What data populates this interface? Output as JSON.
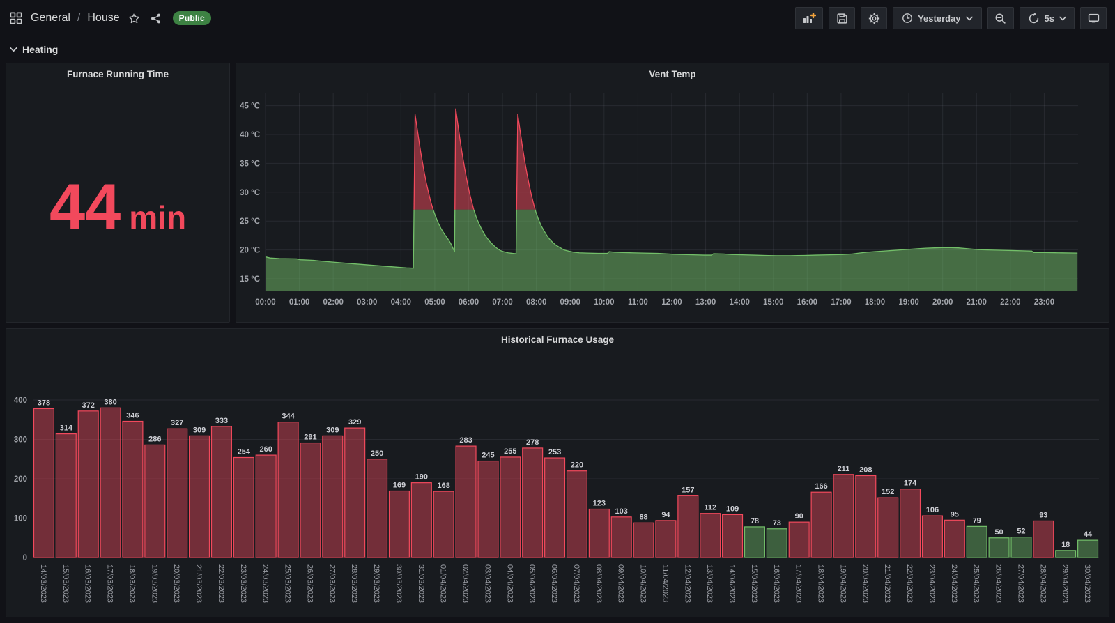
{
  "header": {
    "breadcrumb": {
      "section": "General",
      "separator": "/",
      "page": "House"
    },
    "badge": "Public",
    "time_range": "Yesterday",
    "refresh": "5s"
  },
  "row": {
    "title": "Heating"
  },
  "stat_panel": {
    "title": "Furnace Running Time",
    "value": "44",
    "unit": "min",
    "color": "#F2495C"
  },
  "icons": {
    "dashboards-icon": "four-squares-grid",
    "star-icon": "star-outline",
    "share-icon": "share-nodes",
    "add-panel-icon": "bar-chart-plus",
    "save-icon": "floppy-disk",
    "settings-icon": "gear",
    "clock-icon": "clock",
    "chevron-down-icon": "chevron-down",
    "zoom-out-icon": "magnifier-minus",
    "refresh-icon": "circular-arrows",
    "tv-icon": "monitor",
    "accent_orange": "#F2A33C",
    "icon_color": "#c7c9cc"
  },
  "chart_data": [
    {
      "type": "area",
      "title": "Vent Temp",
      "ylim": [
        12.9,
        47.3
      ],
      "yticks": [
        15,
        20,
        25,
        30,
        35,
        40,
        45
      ],
      "ytick_suffix": " °C",
      "xticks": [
        "00:00",
        "01:00",
        "02:00",
        "03:00",
        "04:00",
        "05:00",
        "06:00",
        "07:00",
        "08:00",
        "09:00",
        "10:00",
        "11:00",
        "12:00",
        "13:00",
        "14:00",
        "15:00",
        "16:00",
        "17:00",
        "18:00",
        "19:00",
        "20:00",
        "21:00",
        "22:00",
        "23:00"
      ],
      "x_total_minutes": 1440,
      "threshold": 27,
      "color_below": "#73BF69",
      "color_above": "#F2495C",
      "fill_opacity": 0.5,
      "grid": true,
      "points": [
        [
          0,
          18.8
        ],
        [
          8,
          18.6
        ],
        [
          25,
          18.5
        ],
        [
          55,
          18.45
        ],
        [
          62,
          18.3
        ],
        [
          85,
          18.2
        ],
        [
          100,
          18.05
        ],
        [
          118,
          17.9
        ],
        [
          137,
          17.75
        ],
        [
          155,
          17.6
        ],
        [
          175,
          17.45
        ],
        [
          195,
          17.3
        ],
        [
          215,
          17.15
        ],
        [
          235,
          17.0
        ],
        [
          250,
          16.9
        ],
        [
          262,
          16.85
        ],
        [
          265,
          43.5
        ],
        [
          269,
          40.9
        ],
        [
          273,
          38.2
        ],
        [
          277,
          35.8
        ],
        [
          281,
          33.6
        ],
        [
          285,
          31.6
        ],
        [
          289,
          29.9
        ],
        [
          293,
          28.3
        ],
        [
          297,
          27.0
        ],
        [
          301,
          25.9
        ],
        [
          306,
          24.7
        ],
        [
          311,
          23.7
        ],
        [
          316,
          22.9
        ],
        [
          321,
          22.2
        ],
        [
          326,
          21.5
        ],
        [
          330,
          20.8
        ],
        [
          333,
          20.1
        ],
        [
          335,
          19.8
        ],
        [
          337,
          44.5
        ],
        [
          341,
          41.7
        ],
        [
          345,
          38.9
        ],
        [
          349,
          36.4
        ],
        [
          353,
          34.1
        ],
        [
          357,
          32.0
        ],
        [
          361,
          30.1
        ],
        [
          365,
          28.5
        ],
        [
          369,
          27.0
        ],
        [
          373,
          25.8
        ],
        [
          378,
          24.6
        ],
        [
          383,
          23.6
        ],
        [
          388,
          22.7
        ],
        [
          393,
          22.0
        ],
        [
          398,
          21.4
        ],
        [
          404,
          20.8
        ],
        [
          410,
          20.3
        ],
        [
          416,
          19.9
        ],
        [
          422,
          19.7
        ],
        [
          430,
          19.5
        ],
        [
          438,
          19.4
        ],
        [
          444,
          19.35
        ],
        [
          447,
          43.5
        ],
        [
          451,
          40.8
        ],
        [
          455,
          38.1
        ],
        [
          459,
          35.6
        ],
        [
          463,
          33.4
        ],
        [
          467,
          31.4
        ],
        [
          471,
          29.6
        ],
        [
          475,
          28.0
        ],
        [
          479,
          26.6
        ],
        [
          483,
          25.5
        ],
        [
          488,
          24.3
        ],
        [
          493,
          23.4
        ],
        [
          498,
          22.6
        ],
        [
          503,
          21.9
        ],
        [
          509,
          21.3
        ],
        [
          515,
          20.8
        ],
        [
          522,
          20.4
        ],
        [
          529,
          20.0
        ],
        [
          537,
          19.8
        ],
        [
          546,
          19.6
        ],
        [
          556,
          19.5
        ],
        [
          570,
          19.45
        ],
        [
          590,
          19.4
        ],
        [
          606,
          19.4
        ],
        [
          609,
          19.7
        ],
        [
          618,
          19.6
        ],
        [
          632,
          19.55
        ],
        [
          650,
          19.5
        ],
        [
          670,
          19.45
        ],
        [
          695,
          19.4
        ],
        [
          715,
          19.3
        ],
        [
          722,
          19.25
        ],
        [
          740,
          19.2
        ],
        [
          758,
          19.15
        ],
        [
          778,
          19.1
        ],
        [
          790,
          19.1
        ],
        [
          794,
          19.35
        ],
        [
          812,
          19.3
        ],
        [
          826,
          19.2
        ],
        [
          845,
          19.15
        ],
        [
          865,
          19.1
        ],
        [
          885,
          19.05
        ],
        [
          905,
          19.0
        ],
        [
          930,
          19.0
        ],
        [
          955,
          19.05
        ],
        [
          975,
          19.1
        ],
        [
          1000,
          19.15
        ],
        [
          1022,
          19.2
        ],
        [
          1040,
          19.3
        ],
        [
          1052,
          19.45
        ],
        [
          1066,
          19.6
        ],
        [
          1080,
          19.7
        ],
        [
          1095,
          19.8
        ],
        [
          1110,
          19.9
        ],
        [
          1125,
          20.0
        ],
        [
          1140,
          20.1
        ],
        [
          1155,
          20.2
        ],
        [
          1170,
          20.3
        ],
        [
          1185,
          20.35
        ],
        [
          1200,
          20.4
        ],
        [
          1215,
          20.4
        ],
        [
          1228,
          20.35
        ],
        [
          1240,
          20.25
        ],
        [
          1252,
          20.15
        ],
        [
          1264,
          20.05
        ],
        [
          1280,
          20.0
        ],
        [
          1300,
          19.95
        ],
        [
          1322,
          19.9
        ],
        [
          1342,
          19.85
        ],
        [
          1358,
          19.8
        ],
        [
          1361,
          19.55
        ],
        [
          1380,
          19.55
        ],
        [
          1405,
          19.5
        ],
        [
          1439,
          19.45
        ]
      ]
    },
    {
      "type": "bar",
      "title": "Historical Furnace Usage",
      "ylim": [
        0,
        430
      ],
      "yticks": [
        0,
        100,
        200,
        300,
        400
      ],
      "grid": true,
      "color_threshold": 80,
      "color_low": "#73BF69",
      "color_high": "#F2495C",
      "bar_fill_opacity": 0.42,
      "categories": [
        "14/03/2023",
        "15/03/2023",
        "16/03/2023",
        "17/03/2023",
        "18/03/2023",
        "19/03/2023",
        "20/03/2023",
        "21/03/2023",
        "22/03/2023",
        "23/03/2023",
        "24/03/2023",
        "25/03/2023",
        "26/03/2023",
        "27/03/2023",
        "28/03/2023",
        "29/03/2023",
        "30/03/2023",
        "31/03/2023",
        "01/04/2023",
        "02/04/2023",
        "03/04/2023",
        "04/04/2023",
        "05/04/2023",
        "06/04/2023",
        "07/04/2023",
        "08/04/2023",
        "09/04/2023",
        "10/04/2023",
        "11/04/2023",
        "12/04/2023",
        "13/04/2023",
        "14/04/2023",
        "15/04/2023",
        "16/04/2023",
        "17/04/2023",
        "18/04/2023",
        "19/04/2023",
        "20/04/2023",
        "21/04/2023",
        "22/04/2023",
        "23/04/2023",
        "24/04/2023",
        "25/04/2023",
        "26/04/2023",
        "27/04/2023",
        "28/04/2023",
        "29/04/2023",
        "30/04/2023"
      ],
      "values": [
        378,
        314,
        372,
        380,
        346,
        286,
        327,
        309,
        333,
        254,
        260,
        344,
        291,
        309,
        329,
        250,
        169,
        190,
        168,
        283,
        245,
        255,
        278,
        253,
        220,
        123,
        103,
        88,
        94,
        157,
        112,
        109,
        78,
        73,
        90,
        166,
        211,
        208,
        152,
        174,
        106,
        95,
        79,
        50,
        52,
        93,
        18,
        44
      ]
    }
  ]
}
